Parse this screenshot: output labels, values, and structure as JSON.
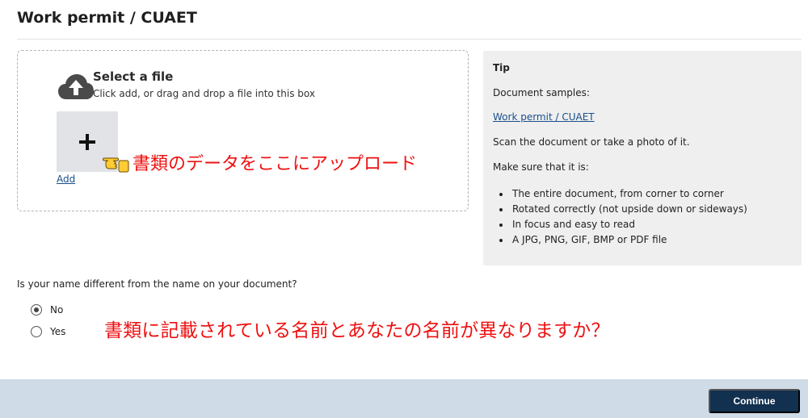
{
  "header": {
    "title": "Work permit / CUAET"
  },
  "upload": {
    "title": "Select a file",
    "hint": "Click add, or drag and drop a file into this box",
    "add_label": "Add",
    "add_symbol": "+",
    "icon": "cloud-upload-icon"
  },
  "annotations": {
    "upload_note": "書類のデータをここにアップロード",
    "name_note": "書類に記載されている名前とあなたの名前が異なりますか？",
    "pointer_icon": "pointing-hand-icon"
  },
  "tip": {
    "title": "Tip",
    "samples_label": "Document samples:",
    "sample_link": "Work permit / CUAET",
    "scan_text": "Scan the document or take a photo of it.",
    "make_sure": "Make sure that it is:",
    "checklist": [
      "The entire document, from corner to corner",
      "Rotated correctly (not upside down or sideways)",
      "In focus and easy to read",
      "A JPG, PNG, GIF, BMP or PDF file"
    ]
  },
  "name_question": {
    "label": "Is your name different from the name on your document?",
    "options": [
      {
        "label": "No",
        "selected": true
      },
      {
        "label": "Yes",
        "selected": false
      }
    ]
  },
  "footer": {
    "continue_label": "Continue"
  },
  "colors": {
    "annotation": "#ee1111",
    "link": "#1a4f8c",
    "primary_button": "#12304f",
    "footer_bg": "#cfdbe7",
    "tip_bg": "#efefef"
  }
}
